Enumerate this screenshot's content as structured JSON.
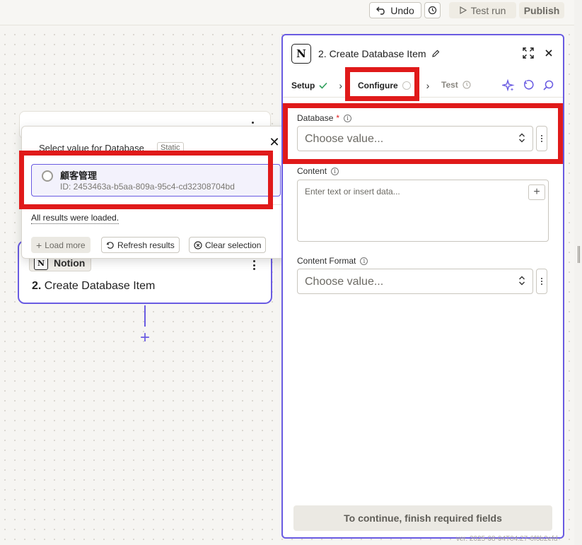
{
  "topbar": {
    "undo_label": "Undo",
    "test_run_label": "Test run",
    "publish_label": "Publish"
  },
  "canvas": {
    "node2": {
      "app_name": "Notion",
      "step_number": "2.",
      "step_title": "Create Database Item"
    }
  },
  "dropdown": {
    "title": "Select value for Database",
    "badge": "Static",
    "options": [
      {
        "name": "顧客管理",
        "id": "ID: 2453463a-b5aa-809a-95c4-cd32308704bd"
      }
    ],
    "status": "All results were loaded.",
    "load_more_label": "Load more",
    "refresh_label": "Refresh results",
    "clear_label": "Clear selection"
  },
  "panel": {
    "title": "2. Create Database Item",
    "tabs": [
      {
        "label": "Setup",
        "state": "done"
      },
      {
        "label": "Configure",
        "state": "active"
      },
      {
        "label": "Test",
        "state": "pending"
      }
    ],
    "fields": {
      "database": {
        "label": "Database",
        "required": "*",
        "placeholder": "Choose value..."
      },
      "content": {
        "label": "Content",
        "placeholder": "Enter text or insert data..."
      },
      "content_format": {
        "label": "Content Format",
        "placeholder": "Choose value..."
      }
    },
    "continue_label": "To continue, finish required fields"
  },
  "colors": {
    "accent": "#695be2",
    "highlight": "#e01a1a",
    "success": "#2e9e5b"
  },
  "version_text": "ver. 2025-08-04T04:27-6f0b2efd"
}
